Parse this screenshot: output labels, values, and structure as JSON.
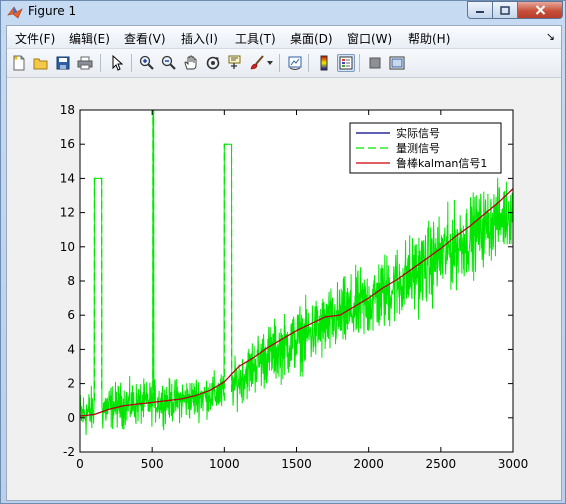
{
  "window": {
    "title": "Figure 1"
  },
  "menu": [
    {
      "label": "文件(F)"
    },
    {
      "label": "编辑(E)"
    },
    {
      "label": "查看(V)"
    },
    {
      "label": "插入(I)"
    },
    {
      "label": "工具(T)"
    },
    {
      "label": "桌面(D)"
    },
    {
      "label": "窗口(W)"
    },
    {
      "label": "帮助(H)"
    }
  ],
  "toolbar_icons": [
    "new-figure-icon",
    "open-file-icon",
    "save-icon",
    "print-icon",
    "pointer-icon",
    "zoom-in-icon",
    "zoom-out-icon",
    "pan-hand-icon",
    "rotate-3d-icon",
    "data-cursor-icon",
    "brush-icon",
    "brush-dropdown-icon",
    "link-plot-icon",
    "colorbar-icon",
    "legend-icon",
    "hide-plot-tools-icon",
    "show-plot-tools-icon"
  ],
  "colors": {
    "actual": "#00008b",
    "measured": "#00e600",
    "kalman": "#cc0000",
    "axes_bg": "#ffffff"
  },
  "chart_data": {
    "type": "line",
    "xlim": [
      0,
      3000
    ],
    "ylim": [
      -2,
      18
    ],
    "x_ticks": [
      0,
      500,
      1000,
      1500,
      2000,
      2500,
      3000
    ],
    "y_ticks": [
      -2,
      0,
      2,
      4,
      6,
      8,
      10,
      12,
      14,
      16,
      18
    ],
    "x_tick_labels": [
      "0",
      "500",
      "1000",
      "1500",
      "2000",
      "2500",
      "3000"
    ],
    "y_tick_labels": [
      "-2",
      "0",
      "2",
      "4",
      "6",
      "8",
      "10",
      "12",
      "14",
      "16",
      "18"
    ],
    "legend_position": "top-right",
    "series": [
      {
        "name": "实际信号",
        "style": "solid",
        "x": [
          0,
          100,
          200,
          300,
          400,
          500,
          600,
          700,
          800,
          900,
          1000,
          1100,
          1200,
          1300,
          1400,
          1500,
          1600,
          1700,
          1800,
          1900,
          2000,
          2100,
          2200,
          2300,
          2400,
          2500,
          2600,
          2700,
          2800,
          2900,
          3000
        ],
        "y": [
          0.1,
          0.2,
          0.5,
          0.7,
          0.8,
          0.9,
          1.0,
          1.1,
          1.3,
          1.6,
          2.1,
          3.0,
          3.5,
          4.1,
          4.6,
          5.1,
          5.5,
          5.9,
          6.0,
          6.5,
          7.0,
          7.6,
          8.1,
          8.7,
          9.3,
          9.9,
          10.6,
          11.2,
          11.9,
          12.6,
          13.4
        ]
      },
      {
        "name": "量测信号",
        "style": "dashed",
        "spikes": [
          {
            "x_start": 100,
            "x_end": 150,
            "y": 14
          },
          {
            "x_start": 505,
            "x_end": 510,
            "y": 18
          },
          {
            "x_start": 1000,
            "x_end": 1050,
            "y": 16
          }
        ],
        "noise_band": [
          {
            "x": 0,
            "low": -1.5,
            "high": 1.8
          },
          {
            "x": 250,
            "low": -0.8,
            "high": 2.2
          },
          {
            "x": 500,
            "low": -0.5,
            "high": 2.3
          },
          {
            "x": 750,
            "low": -0.3,
            "high": 2.5
          },
          {
            "x": 1000,
            "low": 0.2,
            "high": 3.0
          },
          {
            "x": 1250,
            "low": 1.5,
            "high": 5.5
          },
          {
            "x": 1500,
            "low": 2.5,
            "high": 6.8
          },
          {
            "x": 1750,
            "low": 3.4,
            "high": 8.0
          },
          {
            "x": 2000,
            "low": 4.3,
            "high": 9.3
          },
          {
            "x": 2250,
            "low": 5.5,
            "high": 10.8
          },
          {
            "x": 2500,
            "low": 6.8,
            "high": 12.3
          },
          {
            "x": 2750,
            "low": 8.5,
            "high": 13.6
          },
          {
            "x": 3000,
            "low": 10.2,
            "high": 14.5
          }
        ]
      },
      {
        "name": "鲁棒kalman信号1",
        "style": "solid",
        "x": [
          0,
          100,
          200,
          300,
          400,
          500,
          600,
          700,
          800,
          900,
          1000,
          1100,
          1200,
          1300,
          1400,
          1500,
          1600,
          1700,
          1800,
          1900,
          2000,
          2100,
          2200,
          2300,
          2400,
          2500,
          2600,
          2700,
          2800,
          2900,
          3000
        ],
        "y": [
          0.1,
          0.2,
          0.5,
          0.7,
          0.8,
          0.9,
          1.0,
          1.1,
          1.3,
          1.6,
          2.1,
          3.0,
          3.5,
          4.1,
          4.6,
          5.1,
          5.5,
          5.9,
          6.0,
          6.5,
          7.0,
          7.6,
          8.1,
          8.7,
          9.3,
          9.9,
          10.6,
          11.2,
          11.9,
          12.6,
          13.4
        ]
      }
    ]
  }
}
